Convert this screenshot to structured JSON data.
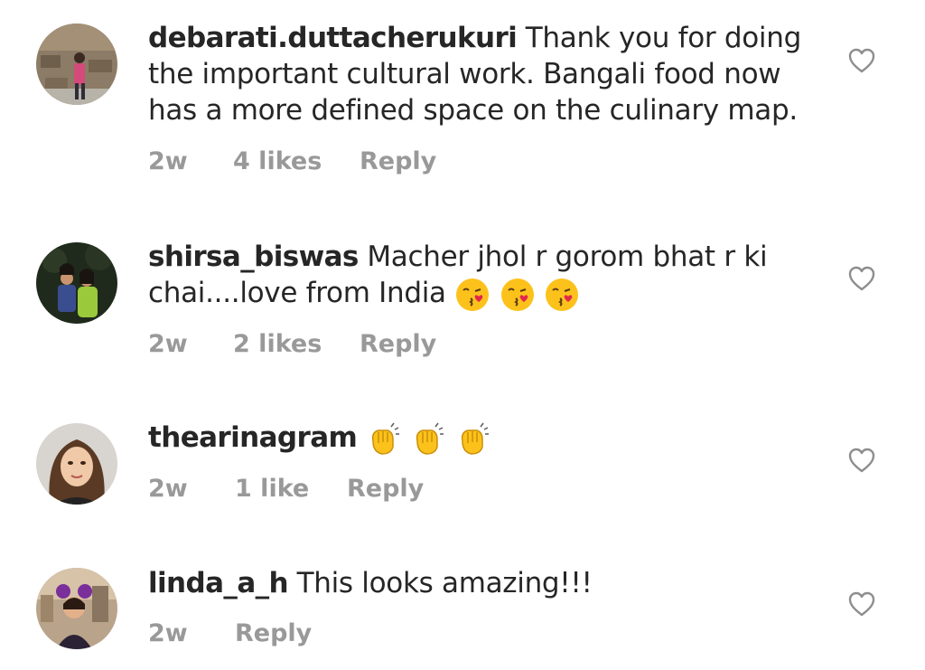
{
  "comments": [
    {
      "username": "debarati.duttacherukuri",
      "lines": [
        "Thank you for doing",
        "the important cultural work. Bangali food now",
        "has a more defined space on the culinary map."
      ],
      "time": "2w",
      "likes": "4 likes",
      "reply": "Reply",
      "avatar_icon": "avatar-woman-pink-stone-wall"
    },
    {
      "username": "shirsa_biswas",
      "lines": [
        "Macher jhol r gorom bhat r ki",
        "chai....love from India"
      ],
      "emoji": [
        "face-blowing-kiss",
        "face-blowing-kiss",
        "face-blowing-kiss"
      ],
      "time": "2w",
      "likes": "2 likes",
      "reply": "Reply",
      "avatar_icon": "avatar-couple-dark"
    },
    {
      "username": "thearinagram",
      "lines": [
        ""
      ],
      "emoji": [
        "clapping-hands",
        "clapping-hands",
        "clapping-hands"
      ],
      "time": "2w",
      "likes": "1 like",
      "reply": "Reply",
      "avatar_icon": "avatar-woman-portrait"
    },
    {
      "username": "linda_a_h",
      "lines": [
        "This looks amazing!!!"
      ],
      "time": "2w",
      "likes": "",
      "reply": "Reply",
      "avatar_icon": "avatar-woman-purple-mall"
    }
  ],
  "colors": {
    "text": "#262626",
    "meta": "#999999",
    "heart_stroke": "#8e8e8e",
    "emoji_yellow": "#fcc21b"
  }
}
